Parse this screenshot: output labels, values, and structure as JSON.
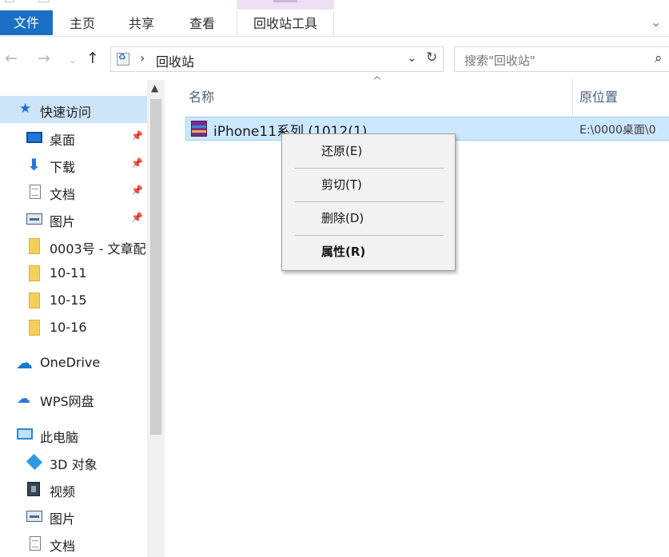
{
  "ribbon": {
    "tabs": [
      {
        "label": "文件"
      },
      {
        "label": "主页"
      },
      {
        "label": "共享"
      },
      {
        "label": "查看"
      },
      {
        "label": "回收站工具"
      }
    ]
  },
  "address": {
    "path": "回收站",
    "search_placeholder": "搜索\"回收站\""
  },
  "sidebar": {
    "quick_access": "快速访问",
    "items": [
      {
        "label": "桌面",
        "icon": "desktop-icon",
        "pinned": true
      },
      {
        "label": "下载",
        "icon": "download-icon",
        "pinned": true
      },
      {
        "label": "文档",
        "icon": "document-icon",
        "pinned": true
      },
      {
        "label": "图片",
        "icon": "pictures-icon",
        "pinned": true
      },
      {
        "label": "0003号 - 文章配",
        "icon": "folder-icon"
      },
      {
        "label": "10-11",
        "icon": "folder-icon"
      },
      {
        "label": "10-15",
        "icon": "folder-icon"
      },
      {
        "label": "10-16",
        "icon": "folder-icon"
      }
    ],
    "onedrive": "OneDrive",
    "wps": "WPS网盘",
    "this_pc": "此电脑",
    "pc_items": [
      {
        "label": "3D 对象",
        "icon": "3d-objects-icon"
      },
      {
        "label": "视频",
        "icon": "video-icon"
      },
      {
        "label": "图片",
        "icon": "pictures-icon"
      },
      {
        "label": "文档",
        "icon": "document-icon"
      }
    ]
  },
  "list": {
    "columns": {
      "name": "名称",
      "original_location": "原位置"
    },
    "rows": [
      {
        "name": "iPhone11系列 (1012(1)",
        "original_location": "E:\\0000桌面\\0",
        "icon": "rar-archive-icon"
      }
    ]
  },
  "context_menu": {
    "items": [
      {
        "label": "还原(E)"
      },
      {
        "label": "剪切(T)"
      },
      {
        "label": "删除(D)"
      },
      {
        "label": "属性(R)",
        "bold": true
      }
    ]
  },
  "colors": {
    "file_tab": "#1a6fc4",
    "selection": "#cce8ff",
    "quick_access_highlight": "#cce4f7"
  }
}
